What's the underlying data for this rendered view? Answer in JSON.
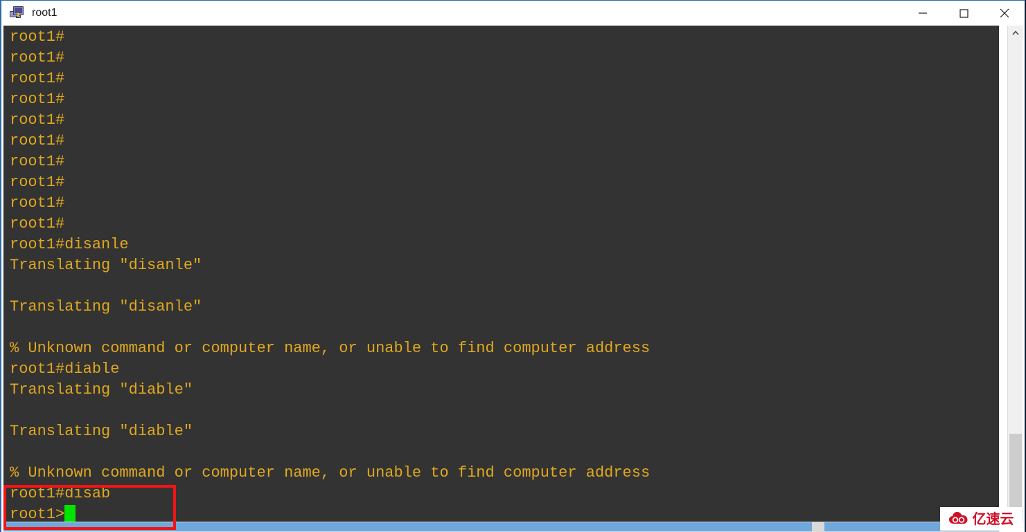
{
  "window": {
    "title": "root1",
    "icon": "remote-desktop-icon",
    "controls": {
      "minimize": "—",
      "maximize": "□",
      "close": "✕"
    }
  },
  "terminal": {
    "background_color": "#333333",
    "text_color": "#e0a81e",
    "cursor_color": "#00e400",
    "lines": [
      "root1#",
      "root1#",
      "root1#",
      "root1#",
      "root1#",
      "root1#",
      "root1#",
      "root1#",
      "root1#",
      "root1#",
      "root1#disanle",
      "Translating \"disanle\"",
      "",
      "Translating \"disanle\"",
      "",
      "% Unknown command or computer name, or unable to find computer address",
      "root1#diable",
      "Translating \"diable\"",
      "",
      "Translating \"diable\"",
      "",
      "% Unknown command or computer name, or unable to find computer address",
      "root1#disab",
      "root1>"
    ],
    "prompt_hash": "root1#",
    "prompt_user": "root1>",
    "commands_typed": [
      "disanle",
      "diable",
      "disab"
    ],
    "error_message": "% Unknown command or computer name, or unable to find computer address"
  },
  "annotation": {
    "highlight_color": "#f01414",
    "highlighted_lines": [
      "root1#disab",
      "root1>"
    ]
  },
  "scrollbars": {
    "vertical": {
      "up_arrow": "ⱏ",
      "down_arrow": "ⱟ",
      "thumb_position": "bottom"
    },
    "horizontal": {
      "thumb_position": "left"
    }
  },
  "watermark": {
    "text": "亿速云",
    "logo": "cloud-logo-icon",
    "color": "#d01028"
  }
}
